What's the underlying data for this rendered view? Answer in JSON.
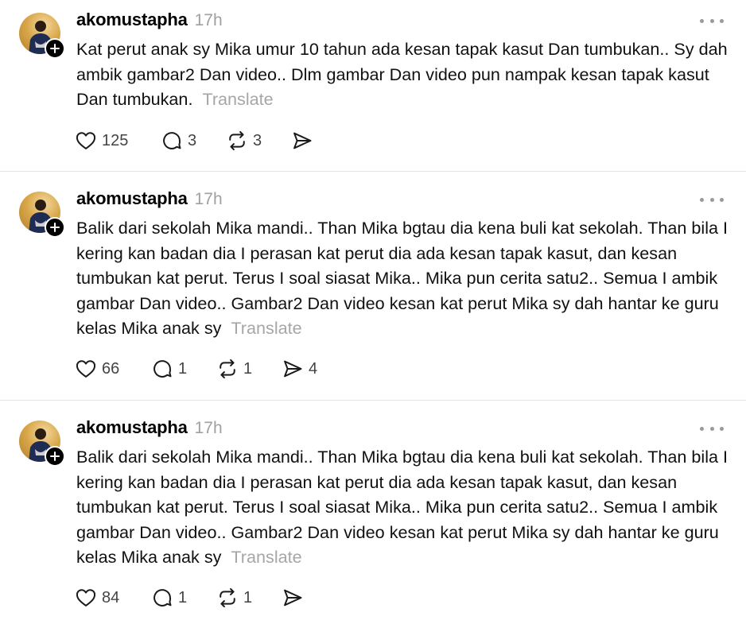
{
  "posts": [
    {
      "username": "akomustapha",
      "time": "17h",
      "text": "Kat perut anak sy Mika umur 10 tahun ada kesan tapak kasut Dan tumbukan.. Sy dah ambik gambar2 Dan video.. Dlm gambar Dan video pun nampak kesan tapak kasut Dan tumbukan.",
      "translate": "Translate",
      "likes": "125",
      "replies": "3",
      "reposts": "3",
      "shares": ""
    },
    {
      "username": "akomustapha",
      "time": "17h",
      "text": "Balik dari sekolah Mika mandi.. Than Mika bgtau dia kena buli kat sekolah. Than bila I kering kan badan dia I perasan kat perut dia ada kesan tapak kasut, dan kesan tumbukan kat perut. Terus I soal siasat Mika.. Mika pun cerita satu2.. Semua I ambik gambar Dan video.. Gambar2 Dan video kesan kat perut Mika sy dah hantar ke guru kelas Mika anak sy",
      "translate": "Translate",
      "likes": "66",
      "replies": "1",
      "reposts": "1",
      "shares": "4"
    },
    {
      "username": "akomustapha",
      "time": "17h",
      "text": "Balik dari sekolah Mika mandi.. Than Mika bgtau dia kena buli kat sekolah. Than bila I kering kan badan dia I perasan kat perut dia ada kesan tapak kasut, dan kesan tumbukan kat perut. Terus I soal siasat Mika.. Mika pun cerita satu2.. Semua I ambik gambar Dan video.. Gambar2 Dan video kesan kat perut Mika sy dah hantar ke guru kelas Mika anak sy",
      "translate": "Translate",
      "likes": "84",
      "replies": "1",
      "reposts": "1",
      "shares": ""
    }
  ],
  "icons": {
    "like": "heart-icon",
    "reply": "comment-icon",
    "repost": "repost-icon",
    "share": "send-icon",
    "more": "more-icon",
    "follow": "plus-icon"
  }
}
